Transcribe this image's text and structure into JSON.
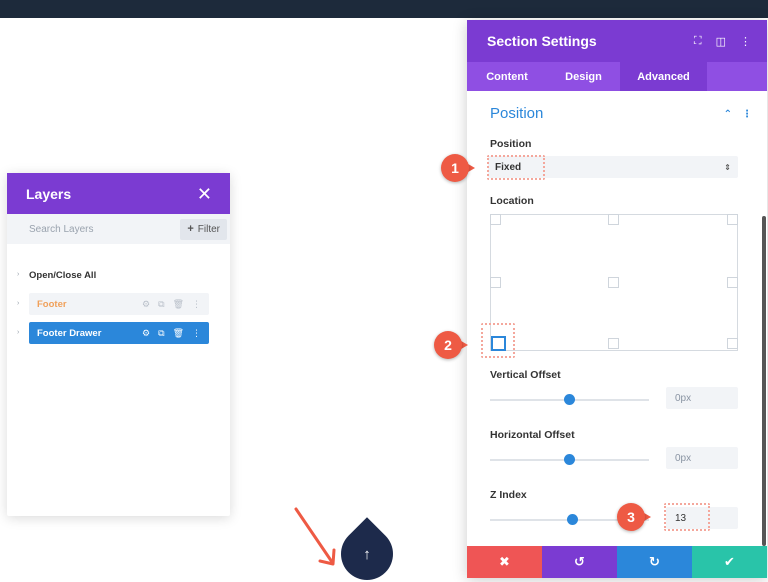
{
  "layers_panel": {
    "title": "Layers",
    "close_glyph": "✕",
    "search_placeholder": "Search Layers",
    "filter_label": "Filter",
    "filter_plus": "+",
    "caret_glyph": "›",
    "open_close_label": "Open/Close All",
    "items": [
      {
        "label": "Footer",
        "color": "#f0a05a"
      },
      {
        "label": "Footer Drawer",
        "color": "#2b87da"
      }
    ],
    "row_icon_glyphs": [
      "⚙",
      "⧉",
      "🗑",
      "⋮"
    ]
  },
  "settings_panel": {
    "title": "Section Settings",
    "header_icon_glyphs": [
      "⛶",
      "◫",
      "⋮"
    ],
    "tabs": [
      {
        "label": "Content"
      },
      {
        "label": "Design"
      },
      {
        "label": "Advanced"
      }
    ],
    "active_tab": "Advanced",
    "section_title": "Position",
    "section_ctrl_glyphs": [
      "⌃",
      "⋮"
    ],
    "position_label": "Position",
    "position_value": "Fixed",
    "select_arrow": "⇕",
    "location_label": "Location",
    "vertical_offset_label": "Vertical Offset",
    "vertical_offset_value": "0px",
    "vertical_offset_level": 0.5,
    "horizontal_offset_label": "Horizontal Offset",
    "horizontal_offset_value": "0px",
    "horizontal_offset_level": 0.5,
    "z_index_label": "Z Index",
    "z_index_value": "13",
    "bottom_buttons": [
      {
        "glyph": "✖"
      },
      {
        "glyph": "↺"
      },
      {
        "glyph": "↻"
      },
      {
        "glyph": "✔"
      }
    ]
  },
  "callouts": [
    "1",
    "2",
    "3"
  ],
  "fab_glyph": "↑",
  "colors": {
    "purple": "#7b3bd2",
    "blue": "#2b87da",
    "red": "#ef5555",
    "green": "#29c4a9",
    "callout": "#ee5a44",
    "topbar": "#1d2a3b"
  }
}
